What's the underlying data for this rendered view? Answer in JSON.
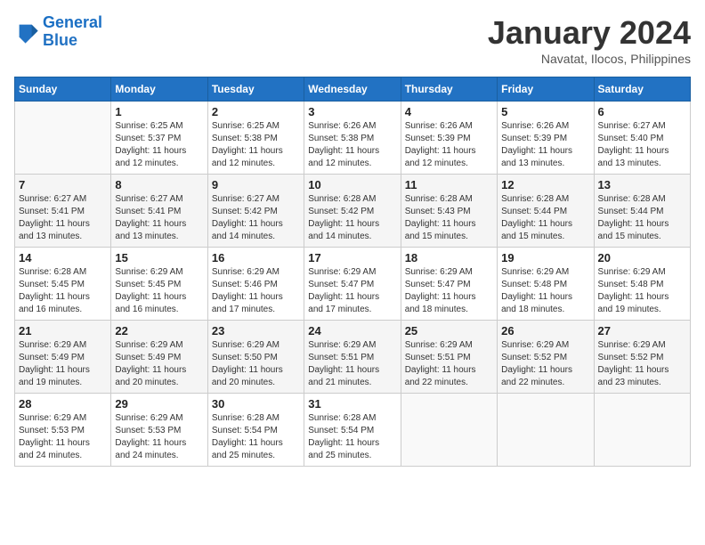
{
  "header": {
    "logo_line1": "General",
    "logo_line2": "Blue",
    "title": "January 2024",
    "location": "Navatat, Ilocos, Philippines"
  },
  "days_of_week": [
    "Sunday",
    "Monday",
    "Tuesday",
    "Wednesday",
    "Thursday",
    "Friday",
    "Saturday"
  ],
  "weeks": [
    [
      {
        "day": "",
        "info": ""
      },
      {
        "day": "1",
        "info": "Sunrise: 6:25 AM\nSunset: 5:37 PM\nDaylight: 11 hours\nand 12 minutes."
      },
      {
        "day": "2",
        "info": "Sunrise: 6:25 AM\nSunset: 5:38 PM\nDaylight: 11 hours\nand 12 minutes."
      },
      {
        "day": "3",
        "info": "Sunrise: 6:26 AM\nSunset: 5:38 PM\nDaylight: 11 hours\nand 12 minutes."
      },
      {
        "day": "4",
        "info": "Sunrise: 6:26 AM\nSunset: 5:39 PM\nDaylight: 11 hours\nand 12 minutes."
      },
      {
        "day": "5",
        "info": "Sunrise: 6:26 AM\nSunset: 5:39 PM\nDaylight: 11 hours\nand 13 minutes."
      },
      {
        "day": "6",
        "info": "Sunrise: 6:27 AM\nSunset: 5:40 PM\nDaylight: 11 hours\nand 13 minutes."
      }
    ],
    [
      {
        "day": "7",
        "info": "Sunrise: 6:27 AM\nSunset: 5:41 PM\nDaylight: 11 hours\nand 13 minutes."
      },
      {
        "day": "8",
        "info": "Sunrise: 6:27 AM\nSunset: 5:41 PM\nDaylight: 11 hours\nand 13 minutes."
      },
      {
        "day": "9",
        "info": "Sunrise: 6:27 AM\nSunset: 5:42 PM\nDaylight: 11 hours\nand 14 minutes."
      },
      {
        "day": "10",
        "info": "Sunrise: 6:28 AM\nSunset: 5:42 PM\nDaylight: 11 hours\nand 14 minutes."
      },
      {
        "day": "11",
        "info": "Sunrise: 6:28 AM\nSunset: 5:43 PM\nDaylight: 11 hours\nand 15 minutes."
      },
      {
        "day": "12",
        "info": "Sunrise: 6:28 AM\nSunset: 5:44 PM\nDaylight: 11 hours\nand 15 minutes."
      },
      {
        "day": "13",
        "info": "Sunrise: 6:28 AM\nSunset: 5:44 PM\nDaylight: 11 hours\nand 15 minutes."
      }
    ],
    [
      {
        "day": "14",
        "info": "Sunrise: 6:28 AM\nSunset: 5:45 PM\nDaylight: 11 hours\nand 16 minutes."
      },
      {
        "day": "15",
        "info": "Sunrise: 6:29 AM\nSunset: 5:45 PM\nDaylight: 11 hours\nand 16 minutes."
      },
      {
        "day": "16",
        "info": "Sunrise: 6:29 AM\nSunset: 5:46 PM\nDaylight: 11 hours\nand 17 minutes."
      },
      {
        "day": "17",
        "info": "Sunrise: 6:29 AM\nSunset: 5:47 PM\nDaylight: 11 hours\nand 17 minutes."
      },
      {
        "day": "18",
        "info": "Sunrise: 6:29 AM\nSunset: 5:47 PM\nDaylight: 11 hours\nand 18 minutes."
      },
      {
        "day": "19",
        "info": "Sunrise: 6:29 AM\nSunset: 5:48 PM\nDaylight: 11 hours\nand 18 minutes."
      },
      {
        "day": "20",
        "info": "Sunrise: 6:29 AM\nSunset: 5:48 PM\nDaylight: 11 hours\nand 19 minutes."
      }
    ],
    [
      {
        "day": "21",
        "info": "Sunrise: 6:29 AM\nSunset: 5:49 PM\nDaylight: 11 hours\nand 19 minutes."
      },
      {
        "day": "22",
        "info": "Sunrise: 6:29 AM\nSunset: 5:49 PM\nDaylight: 11 hours\nand 20 minutes."
      },
      {
        "day": "23",
        "info": "Sunrise: 6:29 AM\nSunset: 5:50 PM\nDaylight: 11 hours\nand 20 minutes."
      },
      {
        "day": "24",
        "info": "Sunrise: 6:29 AM\nSunset: 5:51 PM\nDaylight: 11 hours\nand 21 minutes."
      },
      {
        "day": "25",
        "info": "Sunrise: 6:29 AM\nSunset: 5:51 PM\nDaylight: 11 hours\nand 22 minutes."
      },
      {
        "day": "26",
        "info": "Sunrise: 6:29 AM\nSunset: 5:52 PM\nDaylight: 11 hours\nand 22 minutes."
      },
      {
        "day": "27",
        "info": "Sunrise: 6:29 AM\nSunset: 5:52 PM\nDaylight: 11 hours\nand 23 minutes."
      }
    ],
    [
      {
        "day": "28",
        "info": "Sunrise: 6:29 AM\nSunset: 5:53 PM\nDaylight: 11 hours\nand 24 minutes."
      },
      {
        "day": "29",
        "info": "Sunrise: 6:29 AM\nSunset: 5:53 PM\nDaylight: 11 hours\nand 24 minutes."
      },
      {
        "day": "30",
        "info": "Sunrise: 6:28 AM\nSunset: 5:54 PM\nDaylight: 11 hours\nand 25 minutes."
      },
      {
        "day": "31",
        "info": "Sunrise: 6:28 AM\nSunset: 5:54 PM\nDaylight: 11 hours\nand 25 minutes."
      },
      {
        "day": "",
        "info": ""
      },
      {
        "day": "",
        "info": ""
      },
      {
        "day": "",
        "info": ""
      }
    ]
  ]
}
